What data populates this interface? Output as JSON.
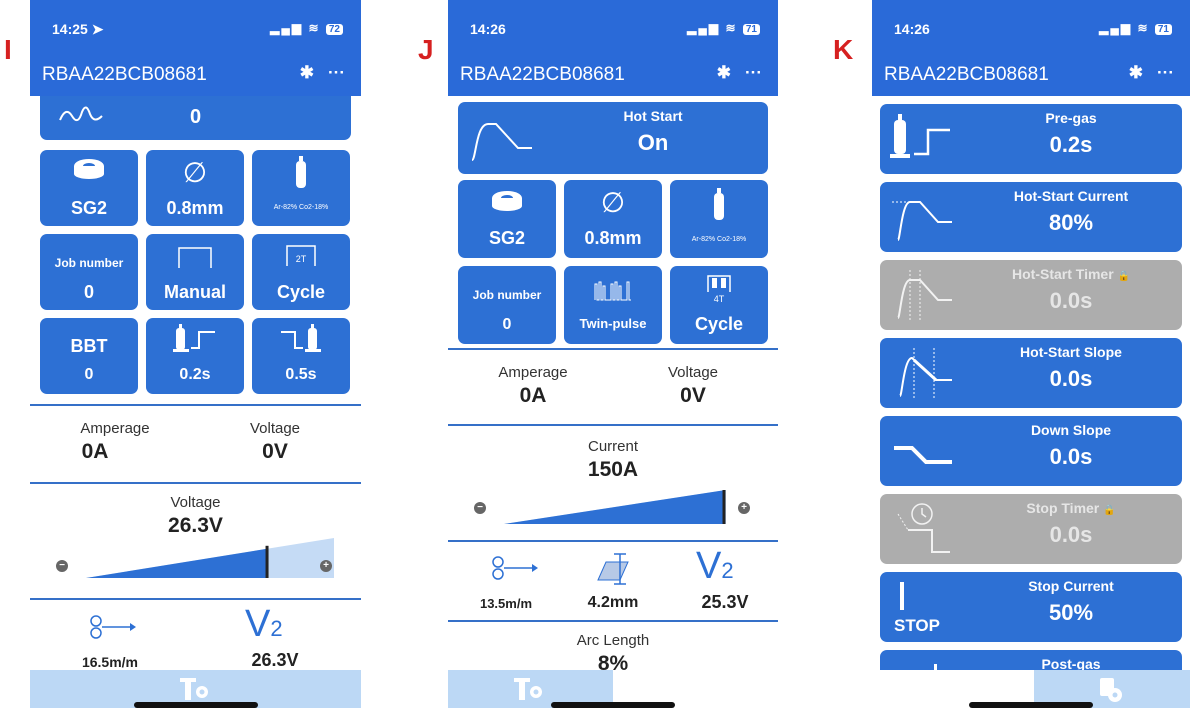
{
  "labels": {
    "i": "I",
    "j": "J",
    "k": "K"
  },
  "colors": {
    "header_blue": "#2a6ad8",
    "tile_blue": "#2d70d4",
    "disabled_grey": "#adadad",
    "bottom_bar": "#bcd8f5",
    "label_red": "#d62020"
  },
  "common": {
    "device": "RBAA22BCB08681",
    "bluetooth": "✱",
    "more": "···",
    "signal": "▂▄▆",
    "wifi": "≋"
  },
  "phone_i": {
    "time": "14:25 ➤",
    "battery": "72",
    "wire_value": "0",
    "wire_type": "SG2",
    "wire_size": "0.8mm",
    "gas": "Ar-82% Co2-18%",
    "job_label": "Job number",
    "job_value": "0",
    "mode": "Manual",
    "cycle_tag": "2T",
    "cycle": "Cycle",
    "bbt_label": "BBT",
    "bbt_value": "0",
    "pregas": "0.2s",
    "postgas": "0.5s",
    "amperage_label": "Amperage",
    "amperage": "0A",
    "voltage_label": "Voltage",
    "voltage": "0V",
    "set_label": "Voltage",
    "set_value": "26.3V",
    "slider_level": 0.73,
    "speed": "16.5m/m",
    "v2": "26.3V",
    "v2_symbol": "V",
    "v2_sub": "2"
  },
  "phone_j": {
    "time": "14:26",
    "battery": "71",
    "hot_start_label": "Hot Start",
    "hot_start_value": "On",
    "wire_type": "SG2",
    "wire_size": "0.8mm",
    "gas": "Ar-82% Co2-18%",
    "job_label": "Job number",
    "job_value": "0",
    "mode": "Twin-pulse",
    "cycle_tag": "4T",
    "cycle": "Cycle",
    "amperage_label": "Amperage",
    "amperage": "0A",
    "voltage_label": "Voltage",
    "voltage": "0V",
    "current_label": "Current",
    "current_value": "150A",
    "slider_level": 1.0,
    "speed": "13.5m/m",
    "thickness": "4.2mm",
    "v2": "25.3V",
    "v2_symbol": "V",
    "v2_sub": "2",
    "arc_label": "Arc Length",
    "arc_value": "8%"
  },
  "phone_k": {
    "time": "14:26",
    "battery": "71",
    "items": [
      {
        "title": "Pre-gas",
        "value": "0.2s",
        "locked": false
      },
      {
        "title": "Hot-Start Current",
        "value": "80%",
        "locked": false
      },
      {
        "title": "Hot-Start Timer",
        "value": "0.0s",
        "locked": true
      },
      {
        "title": "Hot-Start Slope",
        "value": "0.0s",
        "locked": false
      },
      {
        "title": "Down Slope",
        "value": "0.0s",
        "locked": false
      },
      {
        "title": "Stop Timer",
        "value": "0.0s",
        "locked": true
      },
      {
        "title": "Stop Current",
        "value": "50%",
        "locked": false
      },
      {
        "title": "Post-gas",
        "value": "",
        "locked": false
      }
    ],
    "stop_text": "STOP",
    "lock_icon": "🔒"
  }
}
